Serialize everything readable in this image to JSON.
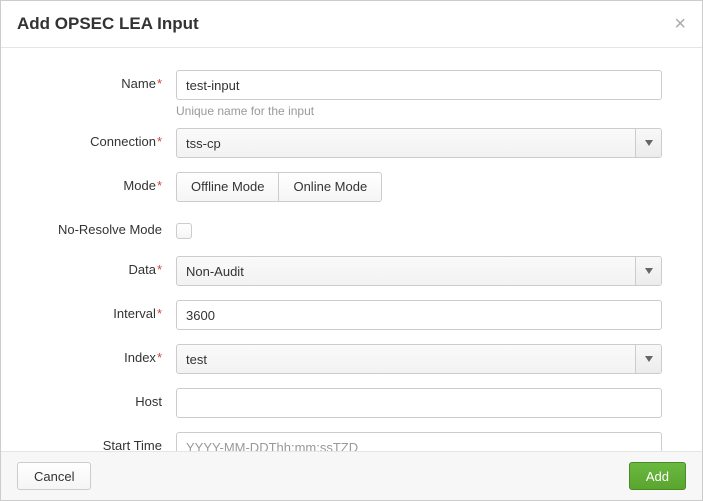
{
  "header": {
    "title": "Add OPSEC LEA Input",
    "close_symbol": "×"
  },
  "form": {
    "name": {
      "label": "Name",
      "required": true,
      "value": "test-input",
      "help": "Unique name for the input"
    },
    "connection": {
      "label": "Connection",
      "required": true,
      "value": "tss-cp"
    },
    "mode": {
      "label": "Mode",
      "required": true,
      "option_offline": "Offline Mode",
      "option_online": "Online Mode"
    },
    "noresolve": {
      "label": "No-Resolve Mode",
      "required": false,
      "checked": false
    },
    "data": {
      "label": "Data",
      "required": true,
      "value": "Non-Audit"
    },
    "interval": {
      "label": "Interval",
      "required": true,
      "value": "3600"
    },
    "index": {
      "label": "Index",
      "required": true,
      "value": "test"
    },
    "host": {
      "label": "Host",
      "required": false,
      "value": ""
    },
    "starttime": {
      "label": "Start Time",
      "required": false,
      "value": "",
      "placeholder": "YYYY-MM-DDThh:mm:ssTZD"
    }
  },
  "footer": {
    "cancel": "Cancel",
    "add": "Add"
  }
}
